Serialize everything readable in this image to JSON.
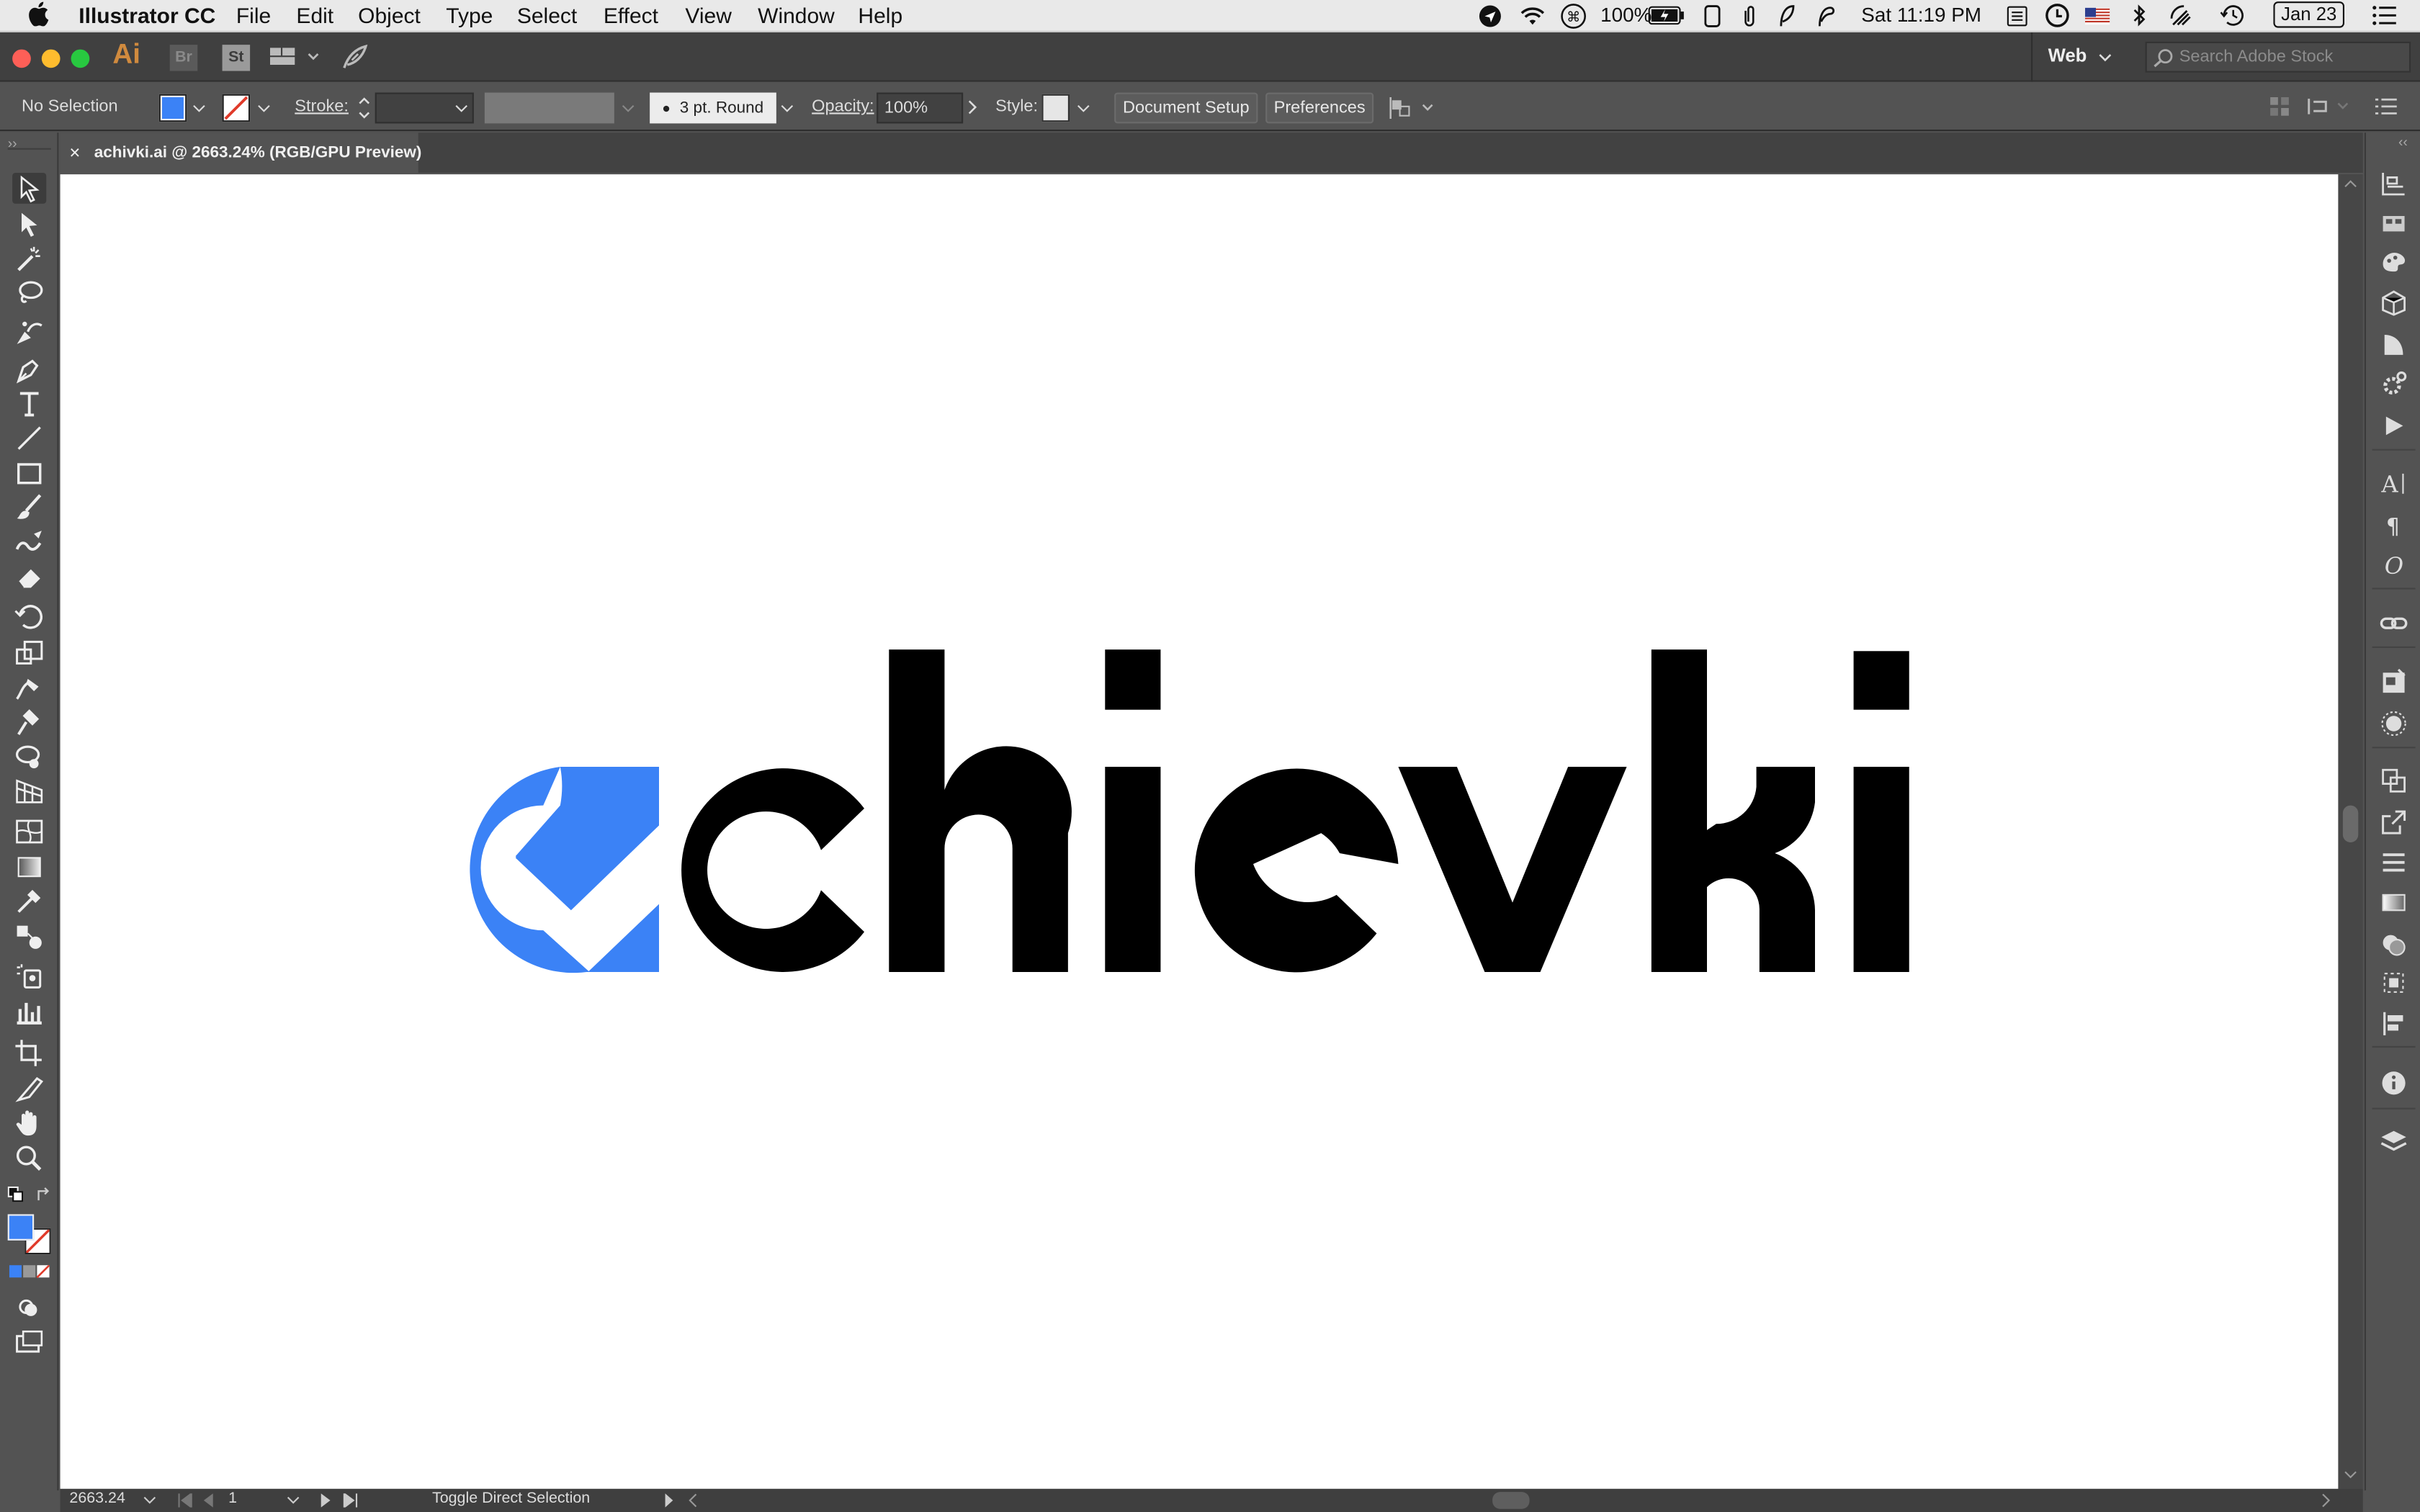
{
  "menubar": {
    "app_name": "Illustrator CC",
    "items": [
      "File",
      "Edit",
      "Object",
      "Type",
      "Select",
      "Effect",
      "View",
      "Window",
      "Help"
    ],
    "battery": "100%",
    "clock": "Sat 11:19 PM",
    "date_badge": "Jan 23"
  },
  "appbar": {
    "ai_label": "Ai",
    "br_label": "Br",
    "st_label": "St",
    "workspace": "Web",
    "search_placeholder": "Search Adobe Stock"
  },
  "control": {
    "selection": "No Selection",
    "stroke_label": "Stroke:",
    "brush": "3 pt. Round",
    "opacity_label": "Opacity:",
    "opacity_value": "100%",
    "style_label": "Style:",
    "doc_setup": "Document Setup",
    "preferences": "Preferences"
  },
  "tab": {
    "close": "×",
    "title": "achivki.ai @ 2663.24% (RGB/GPU Preview)"
  },
  "status": {
    "zoom": "2663.24",
    "artboard": "1",
    "message": "Toggle Direct Selection"
  },
  "colors": {
    "fill": "#3b82f6",
    "logo_blue": "#3b82f6",
    "logo_black": "#000000"
  },
  "artwork": {
    "logo_text": "chievki"
  }
}
